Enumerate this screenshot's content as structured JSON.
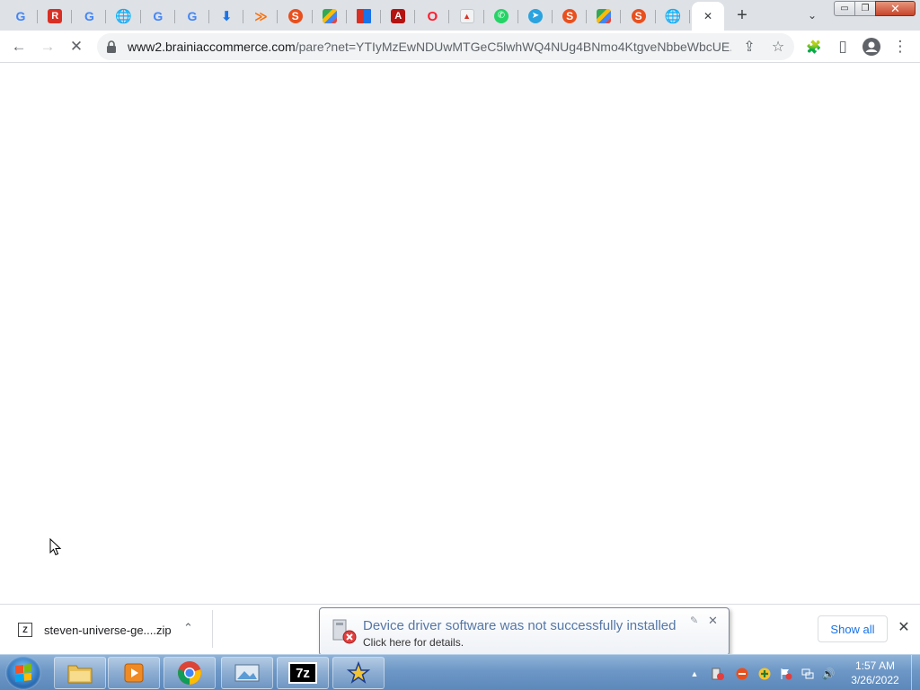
{
  "browser": {
    "tabs": [
      {
        "icon": "google-icon",
        "glyph": "G",
        "class": "g"
      },
      {
        "icon": "r-app-icon",
        "glyph": "R",
        "class": "r"
      },
      {
        "icon": "google-icon",
        "glyph": "G",
        "class": "g"
      },
      {
        "icon": "globe-icon",
        "glyph": "🌐",
        "class": "globe"
      },
      {
        "icon": "google-icon",
        "glyph": "G",
        "class": "g"
      },
      {
        "icon": "google-icon",
        "glyph": "G",
        "class": "g"
      },
      {
        "icon": "download-icon",
        "glyph": "⬇",
        "class": "dl"
      },
      {
        "icon": "chevron-stack-icon",
        "glyph": "≫",
        "class": "chev"
      },
      {
        "icon": "s-logo-icon",
        "glyph": "S",
        "class": "s"
      },
      {
        "icon": "maps-icon",
        "glyph": "",
        "class": "maps"
      },
      {
        "icon": "dictionary-icon",
        "glyph": "",
        "class": "dict"
      },
      {
        "icon": "pdf-icon",
        "glyph": "A",
        "class": "pdf"
      },
      {
        "icon": "opera-icon",
        "glyph": "O",
        "class": "opera"
      },
      {
        "icon": "image-icon",
        "glyph": "▲",
        "class": "img"
      },
      {
        "icon": "whatsapp-icon",
        "glyph": "✆",
        "class": "wa"
      },
      {
        "icon": "telegram-icon",
        "glyph": "➤",
        "class": "tg"
      },
      {
        "icon": "s-logo-icon",
        "glyph": "S",
        "class": "s"
      },
      {
        "icon": "maps-icon",
        "glyph": "",
        "class": "maps"
      },
      {
        "icon": "s-logo-icon",
        "glyph": "S",
        "class": "s"
      },
      {
        "icon": "globe-icon",
        "glyph": "🌐",
        "class": "globe"
      }
    ],
    "active_tab": {
      "icon": "close-icon",
      "glyph": "✕"
    },
    "new_tab_glyph": "+",
    "tab_search_glyph": "⌄",
    "window_controls": {
      "minimize": "▭",
      "maximize": "❐",
      "close": "✕"
    }
  },
  "toolbar": {
    "back_glyph": "←",
    "forward_glyph": "→",
    "stop_glyph": "✕",
    "url_host": "www2.brainiaccommerce.com",
    "url_rest": "/pare?net=YTIyMzEwNDUwMTGeC5lwhWQ4NUg4BNmo4KtgveNbbeWbcUE...",
    "share_glyph": "⇪",
    "star_glyph": "☆",
    "extensions_glyph": "🧩",
    "sidepanel_glyph": "▯",
    "profile_glyph": "●",
    "menu_glyph": "⋮"
  },
  "downloads": {
    "file_name": "steven-universe-ge....zip",
    "file_icon_text": "Z",
    "caret_glyph": "⌃",
    "show_all_label": "Show all",
    "close_glyph": "✕"
  },
  "notification": {
    "title": "Device driver software was not successfully installed",
    "subtitle": "Click here for details.",
    "options_glyph": "✎",
    "close_glyph": "✕"
  },
  "taskbar": {
    "apps": [
      {
        "name": "file-explorer-app",
        "color": "#e8c15a"
      },
      {
        "name": "media-player-app",
        "color": "#f08a24"
      },
      {
        "name": "chrome-app",
        "color": "#db4437"
      },
      {
        "name": "photo-viewer-app",
        "color": "#5b9bd5"
      },
      {
        "name": "7zip-app",
        "color": "#000000",
        "label": "7z"
      },
      {
        "name": "star-app",
        "color": "#f4c430"
      }
    ],
    "tray": {
      "show_hidden_glyph": "▲",
      "volume_glyph": "🔊"
    },
    "clock": {
      "time": "1:57 AM",
      "date": "3/26/2022"
    }
  }
}
